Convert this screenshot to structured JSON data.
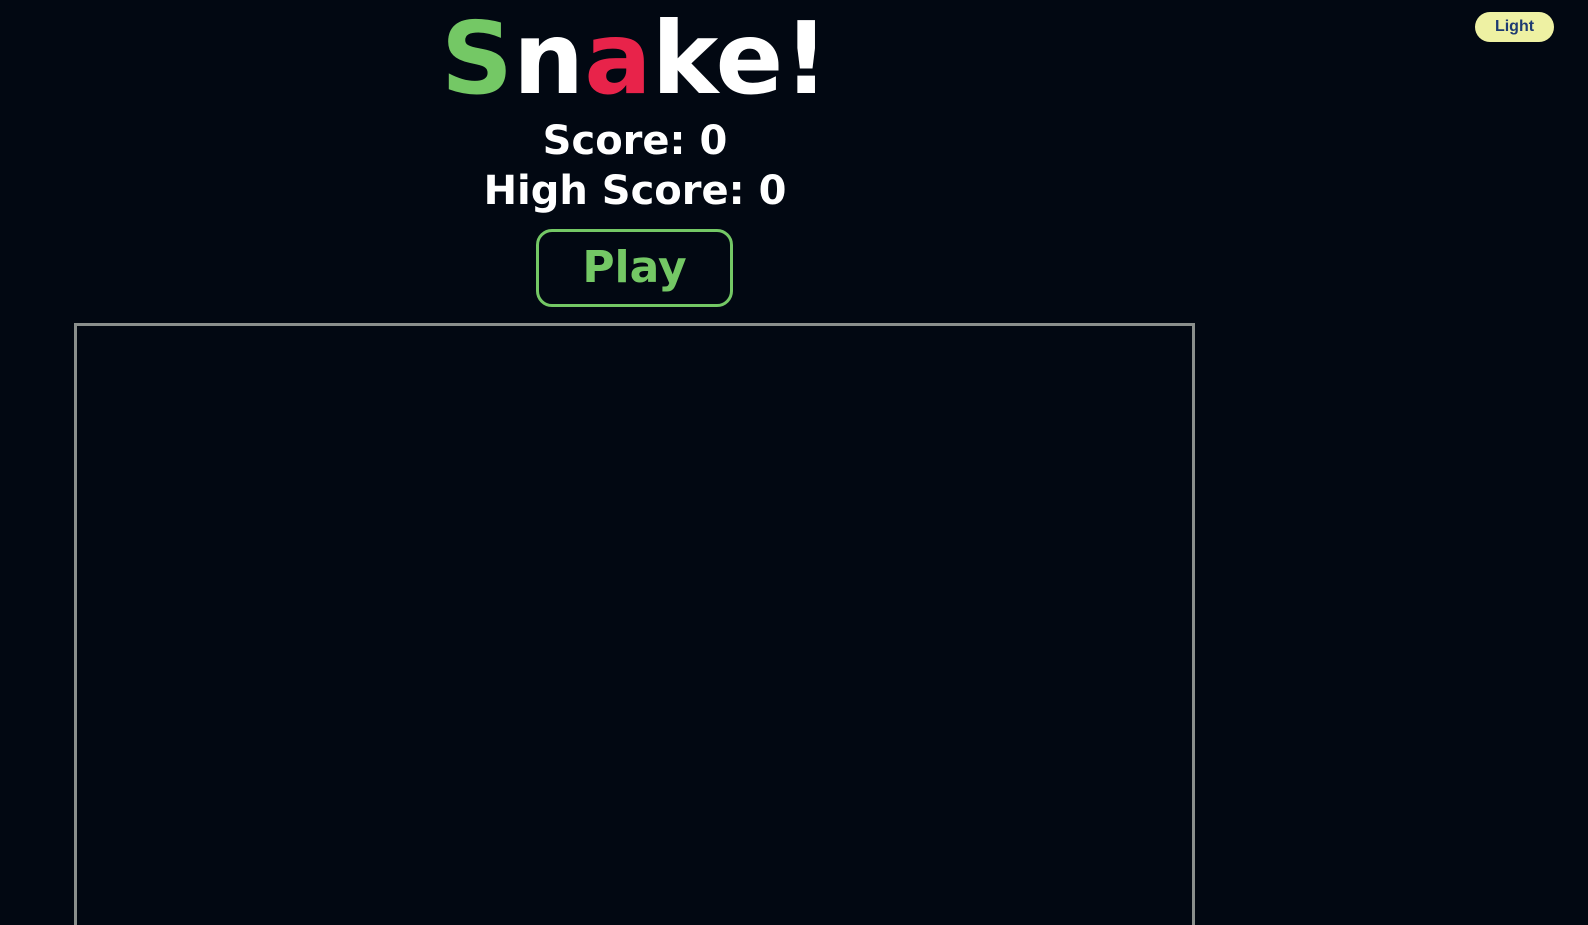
{
  "theme_toggle": {
    "label": "Light"
  },
  "title": {
    "letters": [
      {
        "char": "S",
        "color": "#74c865"
      },
      {
        "char": "n",
        "color": "#ffffff"
      },
      {
        "char": "a",
        "color": "#e8234a"
      },
      {
        "char": "k",
        "color": "#ffffff"
      },
      {
        "char": "e",
        "color": "#ffffff"
      },
      {
        "char": "!",
        "color": "#ffffff"
      }
    ]
  },
  "score": {
    "label": "Score:",
    "value": "0"
  },
  "high_score": {
    "label": "High Score:",
    "value": "0"
  },
  "play_button": {
    "label": "Play",
    "color": "#74c865"
  },
  "colors": {
    "background": "#020812",
    "board_border": "#8a8f8c",
    "toggle_background": "#eef1a3",
    "toggle_text": "#1d3a72"
  }
}
